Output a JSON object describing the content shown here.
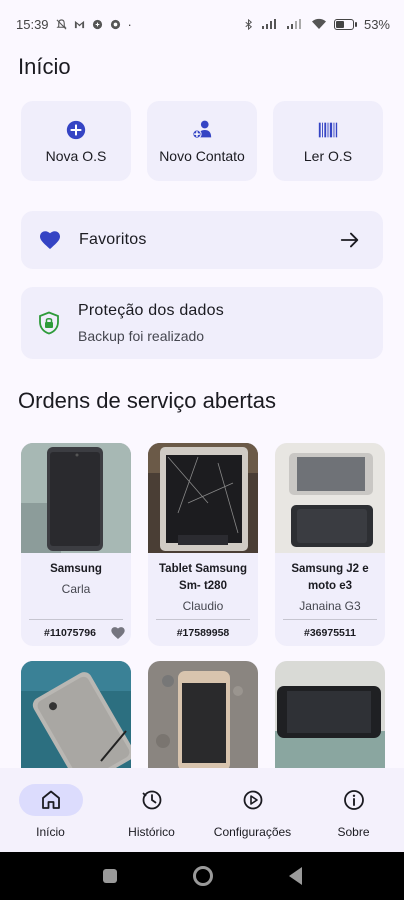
{
  "status_bar": {
    "time": "15:39",
    "dot": "·",
    "battery_percent": "53%",
    "battery_level": 0.53
  },
  "page_title": "Início",
  "quick_actions": [
    {
      "label": "Nova O.S",
      "icon": "add-circle-icon"
    },
    {
      "label": "Novo Contato",
      "icon": "add-person-icon"
    },
    {
      "label": "Ler O.S",
      "icon": "barcode-icon"
    }
  ],
  "favorites": {
    "label": "Favoritos",
    "icon": "heart-icon",
    "action_icon": "arrow-right-icon"
  },
  "data_protection": {
    "title": "Proteção dos dados",
    "subtitle": "Backup foi realizado",
    "icon": "shield-lock-icon"
  },
  "section_title": "Ordens de serviço abertas",
  "orders": [
    {
      "title": "Samsung",
      "client": "Carla",
      "number": "#11075796",
      "favorite": true
    },
    {
      "title": "Tablet Samsung Sm- t280",
      "client": "Claudio",
      "number": "#17589958",
      "favorite": false
    },
    {
      "title": "Samsung J2 e moto e3",
      "client": "Janaina G3",
      "number": "#36975511",
      "favorite": false
    },
    {
      "title": "",
      "client": "",
      "number": "",
      "favorite": false
    },
    {
      "title": "",
      "client": "",
      "number": "",
      "favorite": false
    },
    {
      "title": "",
      "client": "",
      "number": "",
      "favorite": false
    }
  ],
  "bottom_nav": [
    {
      "label": "Início",
      "icon": "home-icon",
      "active": true
    },
    {
      "label": "Histórico",
      "icon": "history-icon",
      "active": false
    },
    {
      "label": "Configurações",
      "icon": "settings-icon",
      "active": false
    },
    {
      "label": "Sobre",
      "icon": "info-icon",
      "active": false
    }
  ],
  "colors": {
    "accent": "#3544c4",
    "card_bg": "#f0eefb",
    "active_pill": "#dcdcfd",
    "shield": "#2e9b3a"
  }
}
